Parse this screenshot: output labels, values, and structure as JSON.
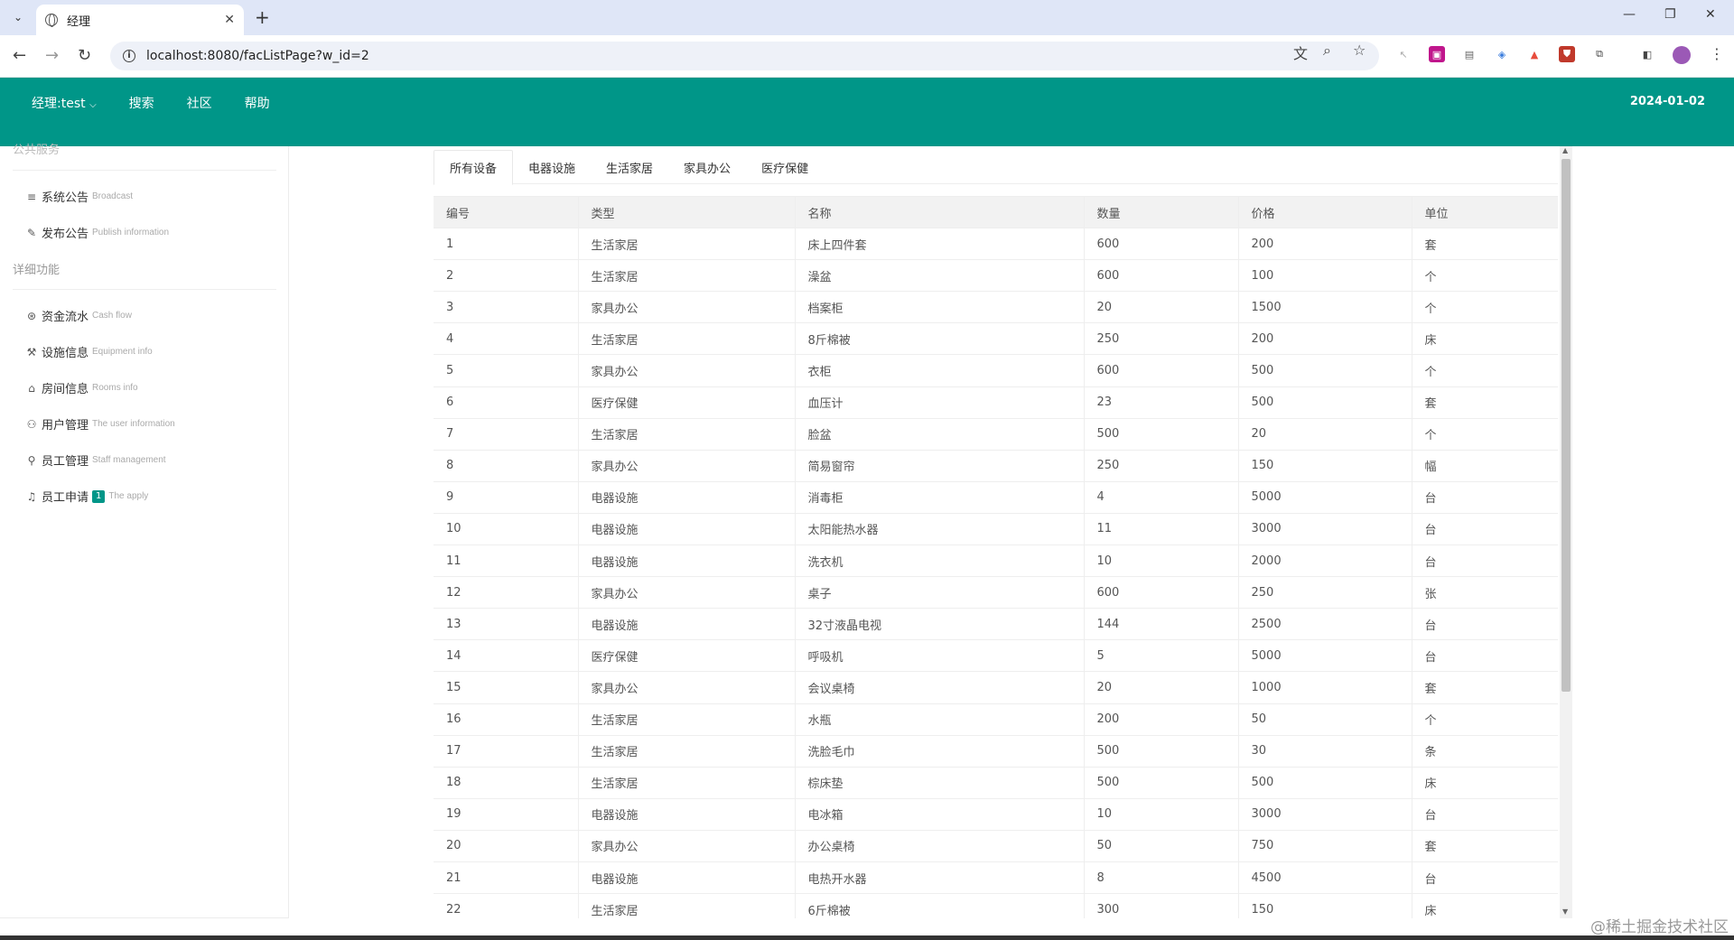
{
  "browser": {
    "tab_title": "经理",
    "url": "localhost:8080/facListPage?w_id=2"
  },
  "header": {
    "user_menu": "经理:test",
    "nav": [
      "搜索",
      "社区",
      "帮助"
    ],
    "date": "2024-01-02"
  },
  "sidebar": {
    "section1": "公共服务",
    "section1_items": [
      {
        "label": "系统公告",
        "sub": "Broadcast",
        "icon": "list-icon"
      },
      {
        "label": "发布公告",
        "sub": "Publish information",
        "icon": "edit-icon"
      }
    ],
    "section2": "详细功能",
    "section2_items": [
      {
        "label": "资金流水",
        "sub": "Cash flow",
        "icon": "coin-icon"
      },
      {
        "label": "设施信息",
        "sub": "Equipment info",
        "icon": "tools-icon"
      },
      {
        "label": "房间信息",
        "sub": "Rooms info",
        "icon": "home-icon"
      },
      {
        "label": "用户管理",
        "sub": "The user information",
        "icon": "users-icon"
      },
      {
        "label": "员工管理",
        "sub": "Staff management",
        "icon": "user-icon"
      },
      {
        "label": "员工申请",
        "sub": "The apply",
        "icon": "bell-icon",
        "badge": "1"
      }
    ]
  },
  "tabs": [
    "所有设备",
    "电器设施",
    "生活家居",
    "家具办公",
    "医疗保健"
  ],
  "table": {
    "columns": [
      "编号",
      "类型",
      "名称",
      "数量",
      "价格",
      "单位"
    ],
    "rows": [
      [
        "1",
        "生活家居",
        "床上四件套",
        "600",
        "200",
        "套"
      ],
      [
        "2",
        "生活家居",
        "澡盆",
        "600",
        "100",
        "个"
      ],
      [
        "3",
        "家具办公",
        "档案柜",
        "20",
        "1500",
        "个"
      ],
      [
        "4",
        "生活家居",
        "8斤棉被",
        "250",
        "200",
        "床"
      ],
      [
        "5",
        "家具办公",
        "衣柜",
        "600",
        "500",
        "个"
      ],
      [
        "6",
        "医疗保健",
        "血压计",
        "23",
        "500",
        "套"
      ],
      [
        "7",
        "生活家居",
        "脸盆",
        "500",
        "20",
        "个"
      ],
      [
        "8",
        "家具办公",
        "简易窗帘",
        "250",
        "150",
        "幅"
      ],
      [
        "9",
        "电器设施",
        "消毒柜",
        "4",
        "5000",
        "台"
      ],
      [
        "10",
        "电器设施",
        "太阳能热水器",
        "11",
        "3000",
        "台"
      ],
      [
        "11",
        "电器设施",
        "洗衣机",
        "10",
        "2000",
        "台"
      ],
      [
        "12",
        "家具办公",
        "桌子",
        "600",
        "250",
        "张"
      ],
      [
        "13",
        "电器设施",
        "32寸液晶电视",
        "144",
        "2500",
        "台"
      ],
      [
        "14",
        "医疗保健",
        "呼吸机",
        "5",
        "5000",
        "台"
      ],
      [
        "15",
        "家具办公",
        "会议桌椅",
        "20",
        "1000",
        "套"
      ],
      [
        "16",
        "生活家居",
        "水瓶",
        "200",
        "50",
        "个"
      ],
      [
        "17",
        "生活家居",
        "洗脸毛巾",
        "500",
        "30",
        "条"
      ],
      [
        "18",
        "生活家居",
        "棕床垫",
        "500",
        "500",
        "床"
      ],
      [
        "19",
        "电器设施",
        "电冰箱",
        "10",
        "3000",
        "台"
      ],
      [
        "20",
        "家具办公",
        "办公桌椅",
        "50",
        "750",
        "套"
      ],
      [
        "21",
        "电器设施",
        "电热开水器",
        "8",
        "4500",
        "台"
      ],
      [
        "22",
        "生活家居",
        "6斤棉被",
        "300",
        "150",
        "床"
      ]
    ]
  },
  "watermark": "@稀土掘金技术社区",
  "colors": {
    "primary": "#009688",
    "badge": "#009688"
  }
}
